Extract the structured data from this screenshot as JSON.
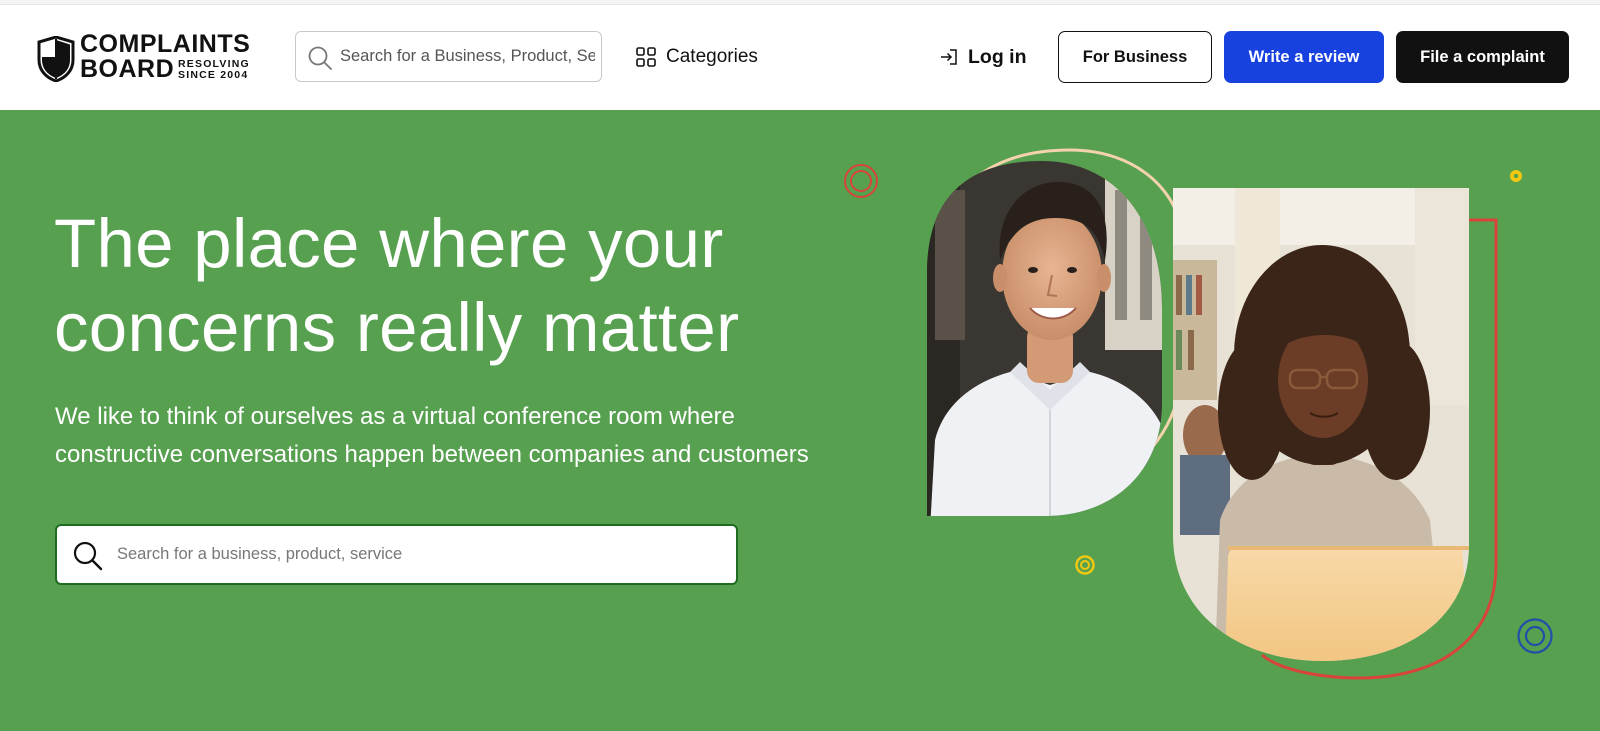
{
  "header": {
    "logo": {
      "line1": "COMPLAINTS",
      "line2": "BOARD",
      "tagline1": "RESOLVING",
      "tagline2": "SINCE 2004"
    },
    "search": {
      "placeholder": "Search for a Business, Product, Service",
      "icon": "search-icon"
    },
    "categories": {
      "label": "Categories",
      "icon": "grid-icon"
    },
    "login": {
      "label": "Log in",
      "icon": "login-arrow-icon"
    },
    "buttons": {
      "for_business": "For Business",
      "write_review": "Write a review",
      "file_complaint": "File a complaint"
    }
  },
  "hero": {
    "headline_line1": "The place where your",
    "headline_line2": "concerns really matter",
    "subtext_line1": "We like to think of ourselves as a virtual conference room where",
    "subtext_line2": "constructive conversations happen between companies and customers",
    "search": {
      "placeholder": "Search for a business, product, service",
      "icon": "search-icon"
    },
    "images": {
      "photo1": "smiling-man-photo",
      "photo2": "woman-with-laptop-photo"
    }
  },
  "colors": {
    "hero_bg": "#57a050",
    "review_button": "#1742e0",
    "complaint_button": "#111111",
    "hero_search_border": "#1e6b22",
    "accent_red": "#d9443a",
    "accent_yellow": "#f2c811",
    "accent_blue": "#1f4fa8",
    "accent_peach": "#f3d2ae"
  }
}
